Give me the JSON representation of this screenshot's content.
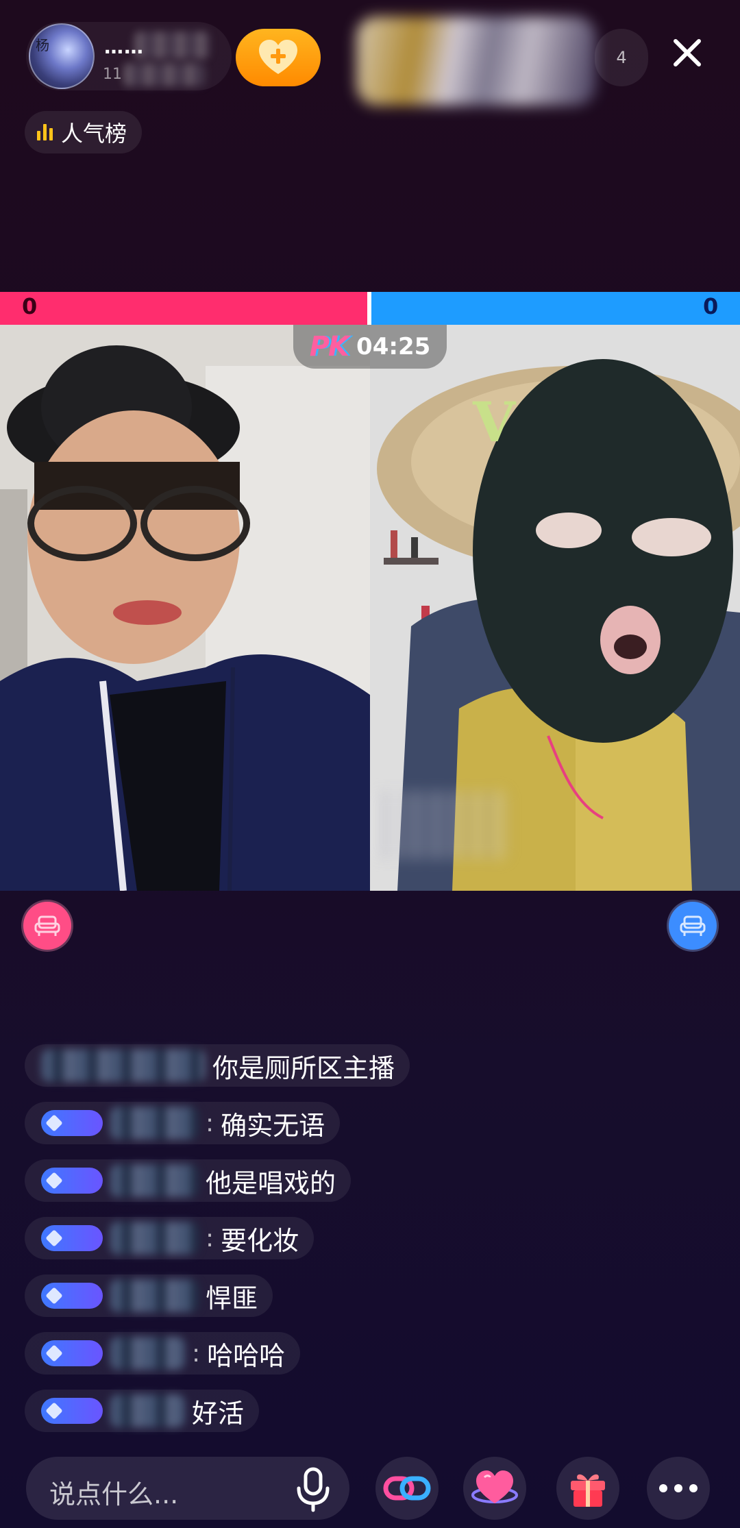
{
  "header": {
    "host_name": "……",
    "host_sub": "11",
    "viewer_count": "4",
    "close_icon": "close-icon",
    "follow_icon": "heart-plus-icon"
  },
  "ranking": {
    "label": "人气榜"
  },
  "pk": {
    "left_score": "0",
    "right_score": "0",
    "logo": "PK",
    "timer": "04:25",
    "left_color": "#ff2d6e",
    "right_color": "#1e9cff"
  },
  "comments": [
    {
      "text": "你是厕所区主播"
    },
    {
      "text": "确实无语"
    },
    {
      "text": "他是唱戏的"
    },
    {
      "text": "要化妆"
    },
    {
      "text": "悍匪"
    },
    {
      "text": "哈哈哈"
    },
    {
      "text": "好活"
    }
  ],
  "bottom": {
    "input_placeholder": "说点什么...",
    "icons": [
      "microphone-icon",
      "link-icon",
      "heart-icon",
      "gift-icon",
      "more-icon"
    ]
  }
}
